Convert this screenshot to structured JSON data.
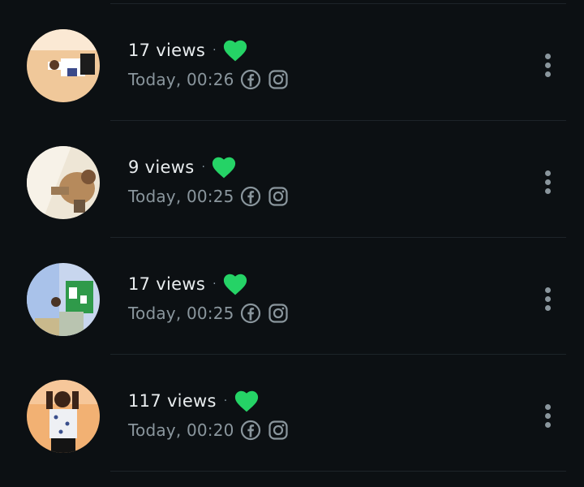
{
  "colors": {
    "background": "#0c1013",
    "heart": "#25d366",
    "primary_text": "#e9edef",
    "secondary_text": "#8a969d"
  },
  "separator": "·",
  "status_rows": [
    {
      "views": "17 views",
      "time": "Today, 00:26",
      "avatar_tone": "peach"
    },
    {
      "views": "9 views",
      "time": "Today, 00:25",
      "avatar_tone": "tan"
    },
    {
      "views": "17 views",
      "time": "Today, 00:25",
      "avatar_tone": "blue-green"
    },
    {
      "views": "117 views",
      "time": "Today, 00:20",
      "avatar_tone": "orange"
    }
  ],
  "icons": {
    "heart": "heart-icon",
    "facebook": "facebook-icon",
    "instagram": "instagram-icon",
    "menu": "more-vertical-icon"
  }
}
